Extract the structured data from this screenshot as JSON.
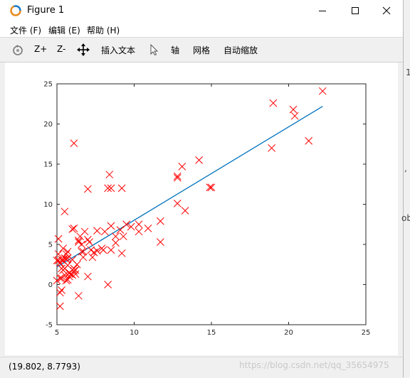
{
  "window": {
    "title": "Figure 1"
  },
  "menu": {
    "file": "文件 (F)",
    "edit": "编辑 (E)",
    "help": "帮助 (H)"
  },
  "toolbar": {
    "zoom_in": "Z+",
    "zoom_out": "Z-",
    "insert_text": "插入文本",
    "axis": "轴",
    "grid": "网格",
    "autoscale": "自动缩放"
  },
  "status": {
    "coords": "(19.802, 8.7793)"
  },
  "watermark": "https://blog.csdn.net/qq_35654975",
  "background_fragments": {
    "one": "1",
    "comma": ",",
    "ob": "ob"
  },
  "colors": {
    "marker": "#ff0000",
    "fit_line": "#0072bd",
    "axes": "#262626"
  },
  "chart_data": {
    "type": "scatter",
    "title": "",
    "xlabel": "",
    "ylabel": "",
    "xlim": [
      5,
      25
    ],
    "ylim": [
      -5,
      25
    ],
    "xticks": [
      5,
      10,
      15,
      20,
      25
    ],
    "yticks": [
      -5,
      0,
      5,
      10,
      15,
      20,
      25
    ],
    "marker": "x",
    "points": [
      [
        6.1,
        17.6
      ],
      [
        5.5,
        9.1
      ],
      [
        5.7,
        0.6
      ],
      [
        8.5,
        12.0
      ],
      [
        6.8,
        6.6
      ],
      [
        5.1,
        3.8
      ],
      [
        5.7,
        3.3
      ],
      [
        8.4,
        13.7
      ],
      [
        6.5,
        6.0
      ],
      [
        5.1,
        3.0
      ],
      [
        5.0,
        3.0
      ],
      [
        14.2,
        15.5
      ],
      [
        5.5,
        3.3
      ],
      [
        5.7,
        4.1
      ],
      [
        5.0,
        0.5
      ],
      [
        12.8,
        13.5
      ],
      [
        10.9,
        7.0
      ],
      [
        5.2,
        -1.0
      ],
      [
        6.1,
        2.0
      ],
      [
        5.5,
        2.0
      ],
      [
        7.2,
        4.3
      ],
      [
        8.3,
        0.0
      ],
      [
        7.3,
        3.4
      ],
      [
        8.0,
        4.3
      ],
      [
        7.4,
        4.0
      ],
      [
        6.2,
        1.8
      ],
      [
        8.3,
        12.0
      ],
      [
        12.8,
        10.1
      ],
      [
        5.3,
        -0.7
      ],
      [
        7.0,
        1.0
      ],
      [
        8.1,
        6.6
      ],
      [
        5.4,
        1.8
      ],
      [
        5.8,
        1.4
      ],
      [
        7.9,
        4.5
      ],
      [
        7.0,
        5.6
      ],
      [
        20.3,
        21.8
      ],
      [
        22.2,
        24.1
      ],
      [
        19.0,
        22.6
      ],
      [
        18.9,
        17.0
      ],
      [
        21.3,
        17.9
      ],
      [
        6.4,
        -1.4
      ],
      [
        5.9,
        1.3
      ],
      [
        5.2,
        -2.7
      ],
      [
        6.4,
        5.5
      ],
      [
        5.1,
        5.7
      ],
      [
        5.5,
        1.2
      ],
      [
        9.5,
        7.5
      ],
      [
        9.8,
        7.2
      ],
      [
        7.4,
        4.0
      ],
      [
        7.1,
        5.3
      ],
      [
        5.2,
        0.8
      ],
      [
        5.7,
        2.4
      ],
      [
        5.8,
        1.5
      ],
      [
        5.6,
        3.2
      ],
      [
        5.3,
        3.1
      ],
      [
        13.3,
        9.2
      ],
      [
        9.3,
        6.0
      ],
      [
        8.8,
        5.2
      ],
      [
        6.0,
        3.1
      ],
      [
        6.2,
        1.3
      ],
      [
        6.7,
        4.1
      ],
      [
        6.6,
        4.1
      ],
      [
        6.1,
        7.0
      ],
      [
        5.3,
        0.8
      ],
      [
        12.8,
        13.3
      ],
      [
        14.9,
        12.1
      ],
      [
        6.7,
        3.4
      ],
      [
        11.7,
        7.9
      ],
      [
        6.6,
        5.0
      ],
      [
        7.0,
        11.9
      ],
      [
        10.3,
        6.6
      ],
      [
        9.2,
        12.0
      ],
      [
        11.7,
        5.3
      ],
      [
        15.0,
        12.1
      ],
      [
        5.3,
        2.0
      ],
      [
        5.4,
        3.0
      ],
      [
        5.6,
        3.8
      ],
      [
        8.5,
        4.3
      ],
      [
        9.2,
        3.9
      ],
      [
        10.3,
        7.5
      ],
      [
        8.5,
        7.3
      ],
      [
        6.4,
        5.3
      ],
      [
        7.6,
        4.2
      ],
      [
        13.1,
        14.7
      ],
      [
        9.1,
        6.8
      ],
      [
        5.8,
        1.0
      ],
      [
        6.3,
        2.5
      ],
      [
        7.6,
        6.7
      ],
      [
        8.8,
        6.0
      ],
      [
        6.0,
        6.9
      ],
      [
        5.2,
        2.7
      ],
      [
        5.4,
        4.5
      ],
      [
        6.1,
        1.7
      ],
      [
        20.4,
        21.0
      ],
      [
        5.6,
        0.5
      ],
      [
        6.0,
        1.2
      ]
    ],
    "fit_line": {
      "x": [
        5.0,
        22.2
      ],
      "y": [
        2.2,
        22.2
      ]
    }
  }
}
